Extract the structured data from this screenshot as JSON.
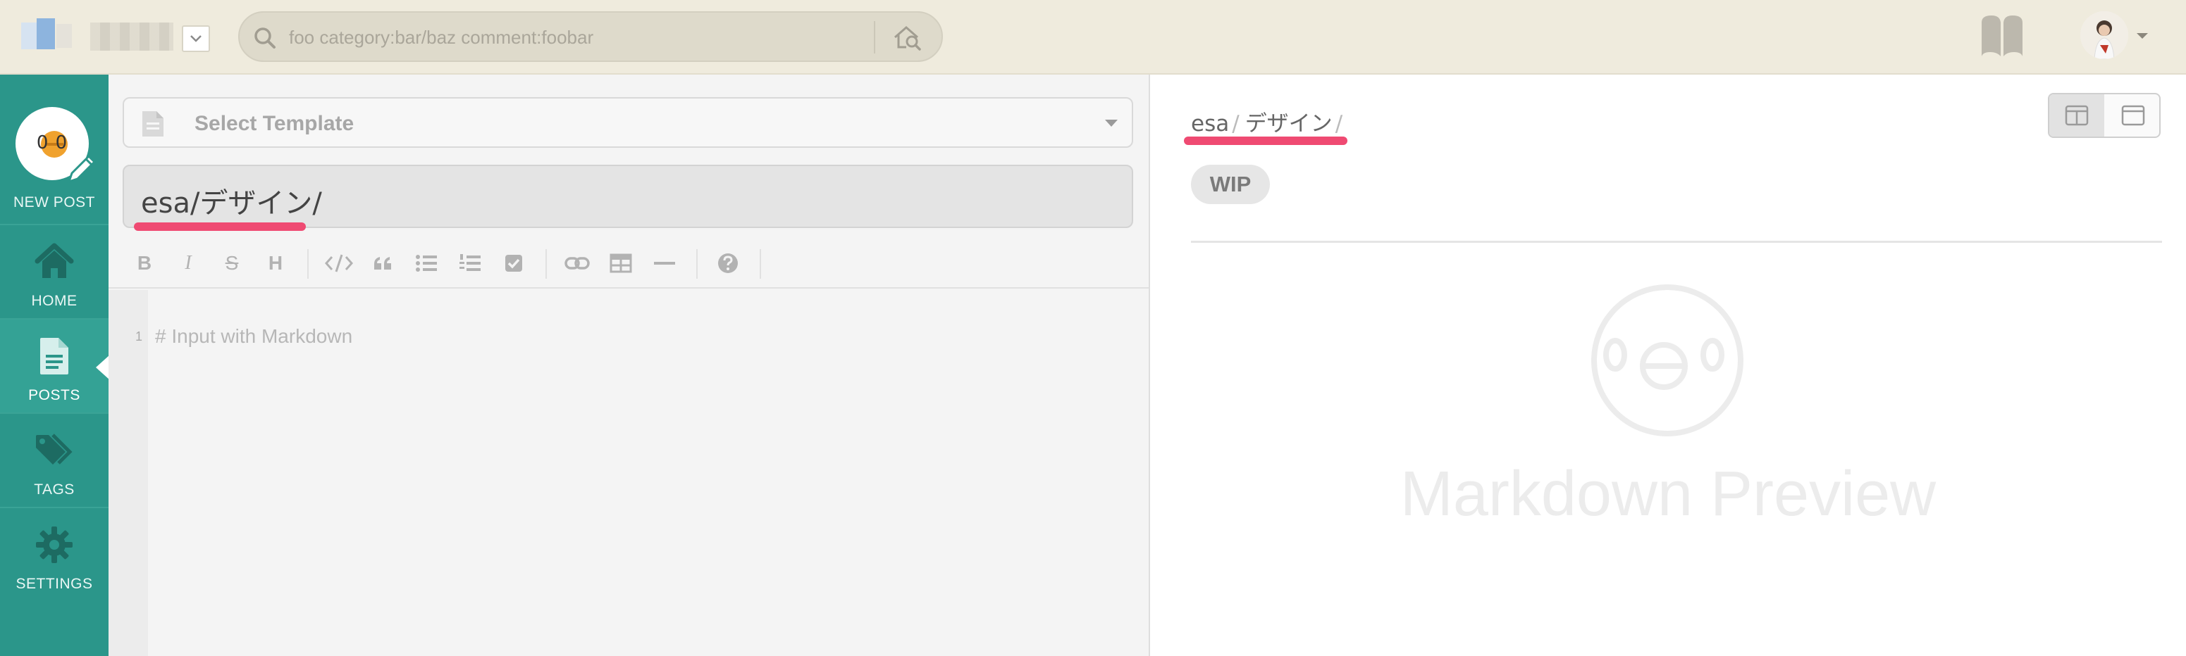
{
  "topbar": {
    "search": {
      "placeholder": "foo category:bar/baz comment:foobar"
    }
  },
  "nav": {
    "new_post": "NEW POST",
    "items": [
      {
        "label": "HOME",
        "icon": "home-icon"
      },
      {
        "label": "POSTS",
        "icon": "document-icon",
        "active": true
      },
      {
        "label": "TAGS",
        "icon": "tags-icon"
      },
      {
        "label": "SETTINGS",
        "icon": "gear-icon"
      }
    ],
    "new_post_face": "0 0"
  },
  "editor": {
    "template_label": "Select Template",
    "title_value": "esa/デザイン/",
    "line_number": "1",
    "body_placeholder": "# Input with Markdown",
    "toolbar": {
      "bold": "B",
      "italic": "I",
      "strike": "S",
      "heading": "H"
    }
  },
  "preview": {
    "breadcrumbs": [
      "esa",
      "デザイン"
    ],
    "breadcrumb_sep": "/",
    "wip_badge": "WIP",
    "placeholder_title": "Markdown Preview"
  },
  "colors": {
    "topbar": "#efebdd",
    "nav": "#2b968a",
    "highlight_underline": "#ef4a72"
  }
}
